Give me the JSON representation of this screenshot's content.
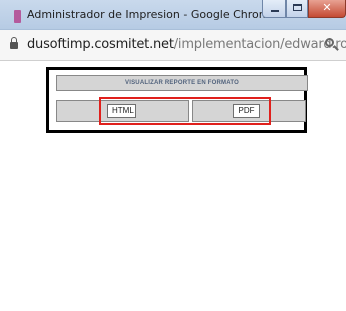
{
  "window": {
    "title": "Administrador de Impresion - Google Chrome",
    "controls": {
      "minimize": "minimize",
      "maximize": "maximize",
      "close_glyph": "✕"
    }
  },
  "address_bar": {
    "host": "dusoftimp.cosmitet.net",
    "path": "/implementacion/edward.ro...",
    "icons": {
      "security": "lock-icon",
      "zoom": "zoom-icon"
    }
  },
  "report": {
    "header": "VISUALIZAR REPORTE EN FORMATO",
    "html_label": "HTML",
    "pdf_label": "PDF"
  },
  "colors": {
    "highlight": "#e0201c",
    "header_text": "#52637d",
    "cell_bg": "#d5d5d5"
  }
}
